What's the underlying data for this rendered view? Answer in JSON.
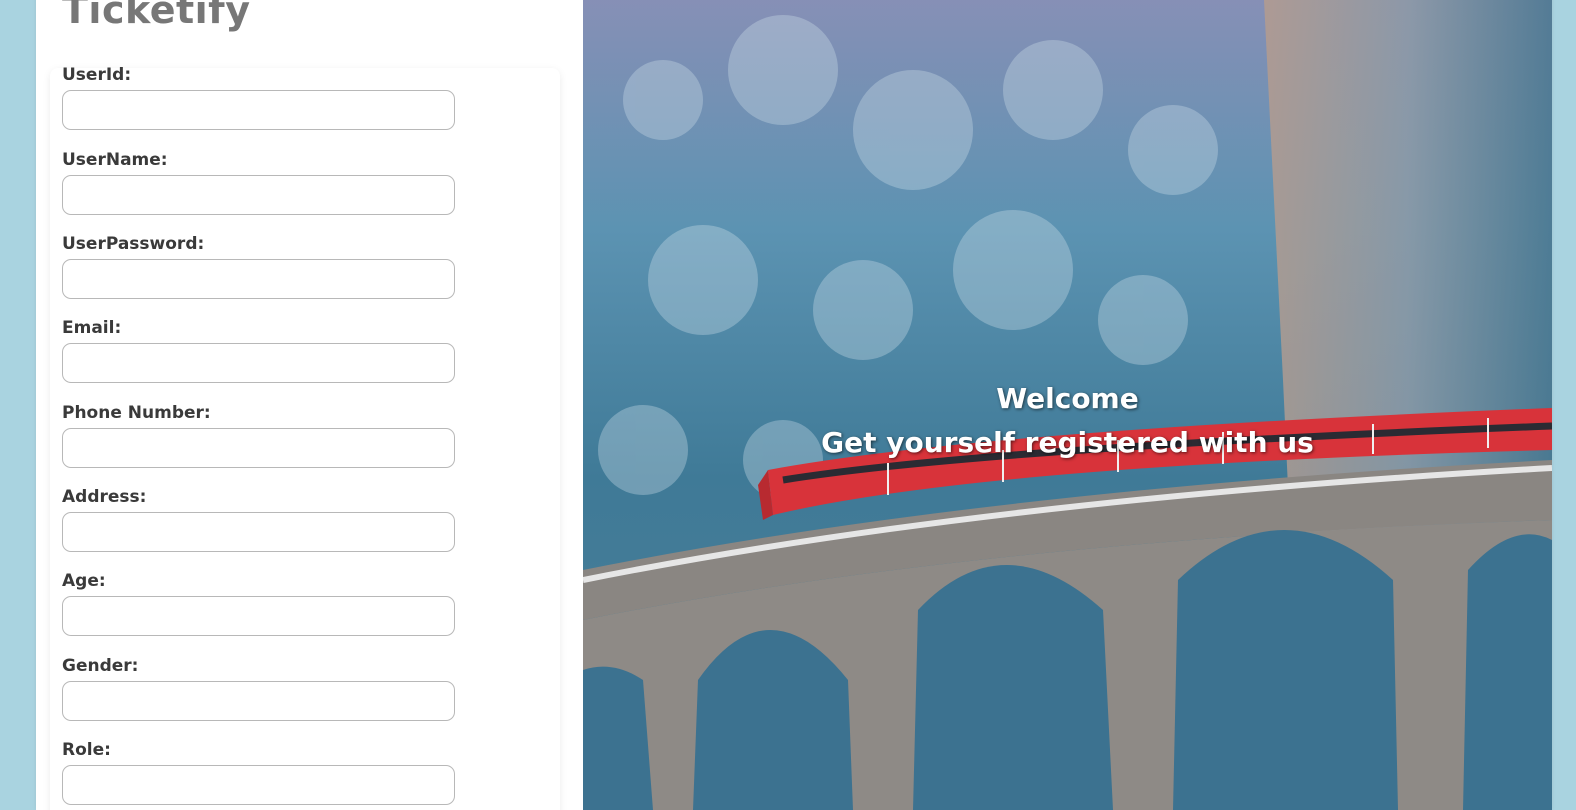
{
  "brand": {
    "title": "Ticketify"
  },
  "form": {
    "fields": [
      {
        "label": "UserId:",
        "value": ""
      },
      {
        "label": "UserName:",
        "value": ""
      },
      {
        "label": "UserPassword:",
        "value": ""
      },
      {
        "label": "Email:",
        "value": ""
      },
      {
        "label": "Phone Number:",
        "value": ""
      },
      {
        "label": "Address:",
        "value": ""
      },
      {
        "label": "Age:",
        "value": ""
      },
      {
        "label": "Gender:",
        "value": ""
      },
      {
        "label": "Role:",
        "value": ""
      }
    ]
  },
  "hero": {
    "welcome": "Welcome",
    "tagline": "Get yourself registered with us"
  },
  "colors": {
    "page_background": "#a9d3e0",
    "train": "#d8333a",
    "text_on_image": "#ffffff"
  }
}
